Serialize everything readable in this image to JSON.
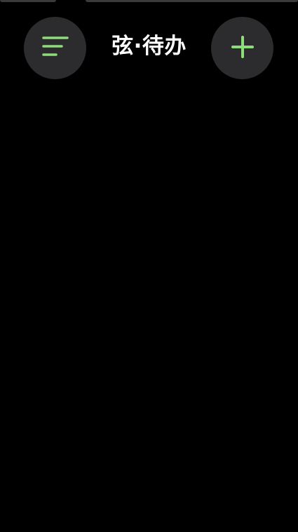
{
  "app": {
    "title": "弦·待办"
  },
  "header": {
    "filter_icon": "sort-lines-icon",
    "add_icon": "plus-icon"
  },
  "colors": {
    "background": "#000000",
    "button_bg": "#2c2c2e",
    "accent": "#8fdc7a",
    "title_text": "#ffffff"
  }
}
